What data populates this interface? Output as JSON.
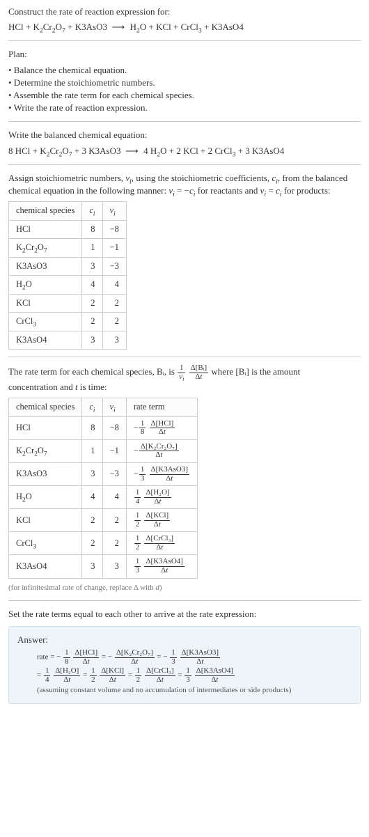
{
  "intro": {
    "heading": "Construct the rate of reaction expression for:",
    "equation": "HCl + K₂Cr₂O₇ + K3AsO3  ⟶  H₂O + KCl + CrCl₃ + K3AsO4"
  },
  "plan": {
    "heading": "Plan:",
    "bullets": [
      "• Balance the chemical equation.",
      "• Determine the stoichiometric numbers.",
      "• Assemble the rate term for each chemical species.",
      "• Write the rate of reaction expression."
    ]
  },
  "balanced": {
    "heading": "Write the balanced chemical equation:",
    "equation": "8 HCl + K₂Cr₂O₇ + 3 K3AsO3  ⟶  4 H₂O + 2 KCl + 2 CrCl₃ + 3 K3AsO4"
  },
  "assign": {
    "text_before": "Assign stoichiometric numbers, νᵢ, using the stoichiometric coefficients, cᵢ, from the balanced chemical equation in the following manner: νᵢ = −cᵢ for reactants and νᵢ = cᵢ for products:",
    "table": {
      "headers": [
        "chemical species",
        "cᵢ",
        "νᵢ"
      ],
      "rows": [
        {
          "species": "HCl",
          "c": "8",
          "v": "−8"
        },
        {
          "species": "K₂Cr₂O₇",
          "c": "1",
          "v": "−1"
        },
        {
          "species": "K3AsO3",
          "c": "3",
          "v": "−3"
        },
        {
          "species": "H₂O",
          "c": "4",
          "v": "4"
        },
        {
          "species": "KCl",
          "c": "2",
          "v": "2"
        },
        {
          "species": "CrCl₃",
          "c": "2",
          "v": "2"
        },
        {
          "species": "K3AsO4",
          "c": "3",
          "v": "3"
        }
      ]
    }
  },
  "rate_term": {
    "text_line1": "The rate term for each chemical species, Bᵢ, is ",
    "frac1_num": "1",
    "frac1_den": "νᵢ",
    "frac2_num": "Δ[Bᵢ]",
    "frac2_den": "Δt",
    "text_line1b": " where [Bᵢ] is the amount",
    "text_line2": "concentration and t is time:",
    "table": {
      "headers": [
        "chemical species",
        "cᵢ",
        "νᵢ",
        "rate term"
      ],
      "rows": [
        {
          "species": "HCl",
          "c": "8",
          "v": "−8",
          "sign": "−",
          "coef_num": "1",
          "coef_den": "8",
          "d_num": "Δ[HCl]",
          "d_den": "Δt"
        },
        {
          "species": "K₂Cr₂O₇",
          "c": "1",
          "v": "−1",
          "sign": "−",
          "coef_num": "",
          "coef_den": "",
          "d_num": "Δ[K₂Cr₂O₇]",
          "d_den": "Δt"
        },
        {
          "species": "K3AsO3",
          "c": "3",
          "v": "−3",
          "sign": "−",
          "coef_num": "1",
          "coef_den": "3",
          "d_num": "Δ[K3AsO3]",
          "d_den": "Δt"
        },
        {
          "species": "H₂O",
          "c": "4",
          "v": "4",
          "sign": "",
          "coef_num": "1",
          "coef_den": "4",
          "d_num": "Δ[H₂O]",
          "d_den": "Δt"
        },
        {
          "species": "KCl",
          "c": "2",
          "v": "2",
          "sign": "",
          "coef_num": "1",
          "coef_den": "2",
          "d_num": "Δ[KCl]",
          "d_den": "Δt"
        },
        {
          "species": "CrCl₃",
          "c": "2",
          "v": "2",
          "sign": "",
          "coef_num": "1",
          "coef_den": "2",
          "d_num": "Δ[CrCl₃]",
          "d_den": "Δt"
        },
        {
          "species": "K3AsO4",
          "c": "3",
          "v": "3",
          "sign": "",
          "coef_num": "1",
          "coef_den": "3",
          "d_num": "Δ[K3AsO4]",
          "d_den": "Δt"
        }
      ]
    },
    "footnote": "(for infinitesimal rate of change, replace Δ with d)"
  },
  "set_equal": "Set the rate terms equal to each other to arrive at the rate expression:",
  "answer": {
    "label": "Answer:",
    "line1": {
      "prefix": "rate = −",
      "t1_num": "1",
      "t1_den": "8",
      "d1_num": "Δ[HCl]",
      "d1_den": "Δt",
      "eq1": " = −",
      "d2_num": "Δ[K₂Cr₂O₇]",
      "d2_den": "Δt",
      "eq2": " = −",
      "t3_num": "1",
      "t3_den": "3",
      "d3_num": "Δ[K3AsO3]",
      "d3_den": "Δt"
    },
    "line2": {
      "prefix": "= ",
      "t4_num": "1",
      "t4_den": "4",
      "d4_num": "Δ[H₂O]",
      "d4_den": "Δt",
      "eq4": " = ",
      "t5_num": "1",
      "t5_den": "2",
      "d5_num": "Δ[KCl]",
      "d5_den": "Δt",
      "eq5": " = ",
      "t6_num": "1",
      "t6_den": "2",
      "d6_num": "Δ[CrCl₃]",
      "d6_den": "Δt",
      "eq6": " = ",
      "t7_num": "1",
      "t7_den": "3",
      "d7_num": "Δ[K3AsO4]",
      "d7_den": "Δt"
    },
    "assume": "(assuming constant volume and no accumulation of intermediates or side products)"
  }
}
